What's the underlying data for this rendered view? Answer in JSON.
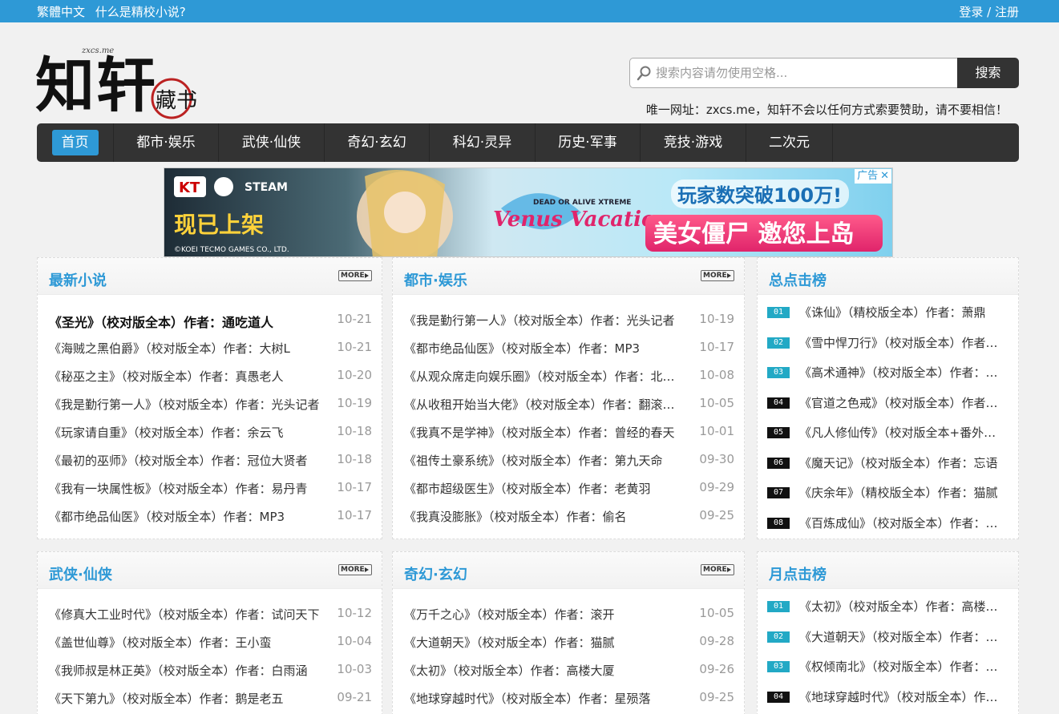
{
  "topbar": {
    "traditional": "繁體中文",
    "about": "什么是精校小说?",
    "login": "登录",
    "sep": " / ",
    "register": "注册"
  },
  "logo": {
    "text": "知轩藏书",
    "subtext": "zxcs.me"
  },
  "search": {
    "placeholder": "搜索内容请勿使用空格...",
    "button": "搜索"
  },
  "notice": "唯一网址：zxcs.me，知轩不会以任何方式索要赞助，请不要相信！",
  "nav": {
    "items": [
      "首页",
      "都市·娱乐",
      "武侠·仙侠",
      "奇幻·玄幻",
      "科幻·灵异",
      "历史·军事",
      "竞技·游戏",
      "二次元"
    ],
    "active": 0
  },
  "ad": {
    "label": "广告",
    "close": "✕",
    "brand1": "KT",
    "brand2": "STEAM",
    "released": "现已上架",
    "game_tag": "DEAD OR ALIVE XTREME",
    "game": "Venus Vacation",
    "copyright": "©KOEI TECMO GAMES CO., LTD.",
    "slogan1": "玩家数突破100万!",
    "slogan2": "美女僵尸 邀您上岛"
  },
  "more_label": "MORE",
  "panels": {
    "latest": {
      "title": "最新小说",
      "items": [
        {
          "text": "《圣光》（校对版全本）作者：通吃道人",
          "date": "10-21",
          "bold": true
        },
        {
          "text": "《海贼之黑伯爵》（校对版全本）作者：大树L",
          "date": "10-21"
        },
        {
          "text": "《秘巫之主》（校对版全本）作者：真愚老人",
          "date": "10-20"
        },
        {
          "text": "《我是勤行第一人》（校对版全本）作者：光头记者",
          "date": "10-19"
        },
        {
          "text": "《玩家请自重》（校对版全本）作者：余云飞",
          "date": "10-18"
        },
        {
          "text": "《最初的巫师》（校对版全本）作者：冠位大贤者",
          "date": "10-18"
        },
        {
          "text": "《我有一块属性板》（校对版全本）作者：易丹青",
          "date": "10-17"
        },
        {
          "text": "《都市绝品仙医》（校对版全本）作者：MP3",
          "date": "10-17"
        }
      ]
    },
    "urban": {
      "title": "都市·娱乐",
      "items": [
        {
          "text": "《我是勤行第一人》（校对版全本）作者：光头记者",
          "date": "10-19"
        },
        {
          "text": "《都市绝品仙医》（校对版全本）作者：MP3",
          "date": "10-17"
        },
        {
          "text": "《从观众席走向娱乐圈》（校对版全本）作者：北方雪人",
          "date": "10-08"
        },
        {
          "text": "《从收租开始当大佬》（校对版全本）作者：翻滚的土豆",
          "date": "10-05"
        },
        {
          "text": "《我真不是学神》（校对版全本）作者：曾经的春天",
          "date": "10-01"
        },
        {
          "text": "《祖传土豪系统》（校对版全本）作者：第九天命",
          "date": "09-30"
        },
        {
          "text": "《都市超级医生》（校对版全本）作者：老黄羽",
          "date": "09-29"
        },
        {
          "text": "《我真没膨胀》（校对版全本）作者：偷名",
          "date": "09-25"
        }
      ]
    },
    "wuxia": {
      "title": "武侠·仙侠",
      "items": [
        {
          "text": "《修真大工业时代》（校对版全本）作者：试问天下",
          "date": "10-12"
        },
        {
          "text": "《盖世仙尊》（校对版全本）作者：王小蛮",
          "date": "10-04"
        },
        {
          "text": "《我师叔是林正英》（校对版全本）作者：白雨涵",
          "date": "10-03"
        },
        {
          "text": "《天下第九》（校对版全本）作者：鹅是老五",
          "date": "09-21"
        }
      ]
    },
    "fantasy": {
      "title": "奇幻·玄幻",
      "items": [
        {
          "text": "《万千之心》（校对版全本）作者：滚开",
          "date": "10-05"
        },
        {
          "text": "《大道朝天》（校对版全本）作者：猫腻",
          "date": "09-28"
        },
        {
          "text": "《太初》（校对版全本）作者：高楼大厦",
          "date": "09-26"
        },
        {
          "text": "《地球穿越时代》（校对版全本）作者：星殒落",
          "date": "09-25"
        }
      ]
    },
    "total_rank": {
      "title": "总点击榜",
      "items": [
        {
          "num": "01",
          "text": "《诛仙》（精校版全本）作者：萧鼎"
        },
        {
          "num": "02",
          "text": "《雪中悍刀行》（校对版全本）作者：烽火戏诸侯"
        },
        {
          "num": "03",
          "text": "《高术通神》（校对版全本）作者：手握寸关尺"
        },
        {
          "num": "04",
          "text": "《官道之色戒》（校对版全本）作者：雨一"
        },
        {
          "num": "05",
          "text": "《凡人修仙传》（校对版全本+番外）作者：忘语"
        },
        {
          "num": "06",
          "text": "《魔天记》（校对版全本）作者：忘语"
        },
        {
          "num": "07",
          "text": "《庆余年》（精校版全本）作者：猫腻"
        },
        {
          "num": "08",
          "text": "《百炼成仙》（校对版全本）作者：幻雨"
        }
      ]
    },
    "month_rank": {
      "title": "月点击榜",
      "items": [
        {
          "num": "01",
          "text": "《太初》（校对版全本）作者：高楼大厦"
        },
        {
          "num": "02",
          "text": "《大道朝天》（校对版全本）作者：猫腻"
        },
        {
          "num": "03",
          "text": "《权倾南北》（校对版全本）作者：幻雨"
        },
        {
          "num": "04",
          "text": "《地球穿越时代》（校对版全本）作者：星殒落"
        }
      ]
    }
  },
  "colors": {
    "accent": "#2e99d6",
    "nav_bg": "#333333",
    "rank_top": "#22a9c5",
    "rank_rest": "#111111"
  }
}
